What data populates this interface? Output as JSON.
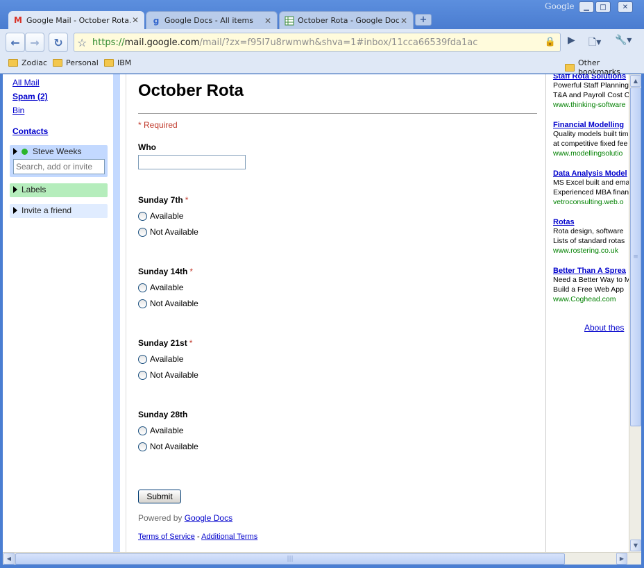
{
  "browser": {
    "brand": "Google",
    "tabs": [
      {
        "title": "Google Mail - October Rota...",
        "active": true,
        "icon": "gmail-icon"
      },
      {
        "title": "Google Docs - All items",
        "active": false,
        "icon": "google-icon"
      },
      {
        "title": "October Rota - Google Docs",
        "active": false,
        "icon": "spreadsheet-icon"
      }
    ],
    "url": {
      "scheme": "https://",
      "host": "mail.google.com",
      "path": "/mail/?zx=f95l7u8rwmwh&shva=1#inbox/11cca66539fda1ac"
    },
    "bookmarks": [
      "Zodiac",
      "Personal",
      "IBM"
    ],
    "other_bookmarks": "Other bookmarks"
  },
  "sidebar": {
    "links": [
      "All Mail",
      "Spam (2)",
      "Bin"
    ],
    "contacts": "Contacts",
    "chat_user": "Steve Weeks",
    "chat_search_placeholder": "Search, add or invite",
    "labels": "Labels",
    "invite": "Invite a friend",
    "colors": {
      "chat_bg": "#c3d9ff",
      "labels_bg": "#b5edbc",
      "invite_bg": "#e0ecff"
    }
  },
  "form": {
    "title": "October Rota",
    "required_note": "* Required",
    "who_label": "Who",
    "questions": [
      {
        "label": "Sunday 7th",
        "required": "*",
        "options": [
          "Available",
          "Not Available"
        ]
      },
      {
        "label": "Sunday 14th",
        "required": "*",
        "options": [
          "Available",
          "Not Available"
        ]
      },
      {
        "label": "Sunday 21st",
        "required": "*",
        "options": [
          "Available",
          "Not Available"
        ]
      },
      {
        "label": "Sunday 28th",
        "required": "",
        "options": [
          "Available",
          "Not Available"
        ]
      }
    ],
    "submit": "Submit",
    "powered_by": "Powered by ",
    "powered_link": "Google Docs",
    "terms": "Terms of Service",
    "terms_sep": " - ",
    "additional": "Additional Terms"
  },
  "ads": [
    {
      "title": "Staff Rota Solutions",
      "lines": [
        "Powerful Staff Planning",
        "T&A and Payroll Cost C"
      ],
      "url": "www.thinking-software"
    },
    {
      "title": "Financial Modelling",
      "lines": [
        "Quality models built tim",
        "at competitive fixed fee"
      ],
      "url": "www.modellingsolutio"
    },
    {
      "title": "Data Analysis Model",
      "lines": [
        "MS Excel built and ema",
        "Experienced MBA finan"
      ],
      "url": "vetroconsulting.web.o"
    },
    {
      "title": "Rotas",
      "lines": [
        "Rota design, software",
        "Lists of standard rotas"
      ],
      "url": "www.rostering.co.uk"
    },
    {
      "title": "Better Than A Sprea",
      "lines": [
        "Need a Better Way to M",
        "Build a Free Web App"
      ],
      "url": "www.Coghead.com"
    }
  ],
  "about_link": "About thes"
}
